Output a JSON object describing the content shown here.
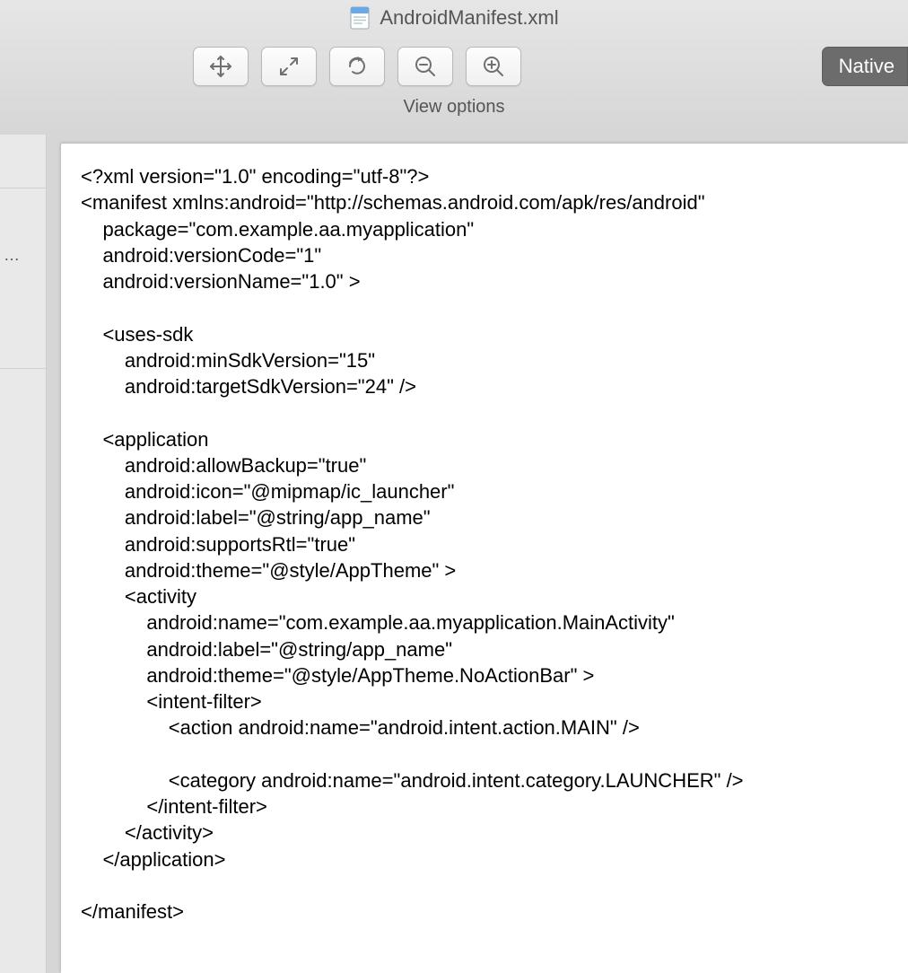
{
  "header": {
    "filename": "AndroidManifest.xml",
    "native_button": "Native",
    "view_options_label": "View options"
  },
  "sidebar": {
    "ellipsis": "…"
  },
  "code": {
    "text": "<?xml version=\"1.0\" encoding=\"utf-8\"?>\n<manifest xmlns:android=\"http://schemas.android.com/apk/res/android\"\n    package=\"com.example.aa.myapplication\"\n    android:versionCode=\"1\"\n    android:versionName=\"1.0\" >\n\n    <uses-sdk\n        android:minSdkVersion=\"15\"\n        android:targetSdkVersion=\"24\" />\n\n    <application\n        android:allowBackup=\"true\"\n        android:icon=\"@mipmap/ic_launcher\"\n        android:label=\"@string/app_name\"\n        android:supportsRtl=\"true\"\n        android:theme=\"@style/AppTheme\" >\n        <activity\n            android:name=\"com.example.aa.myapplication.MainActivity\"\n            android:label=\"@string/app_name\"\n            android:theme=\"@style/AppTheme.NoActionBar\" >\n            <intent-filter>\n                <action android:name=\"android.intent.action.MAIN\" />\n\n                <category android:name=\"android.intent.category.LAUNCHER\" />\n            </intent-filter>\n        </activity>\n    </application>\n\n</manifest>"
  }
}
